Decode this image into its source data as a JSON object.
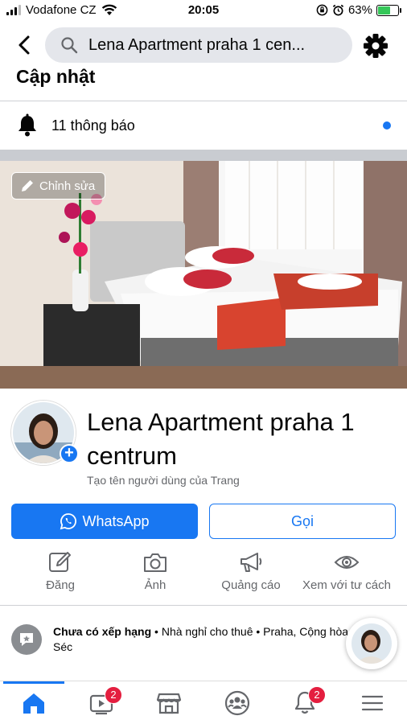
{
  "status_bar": {
    "carrier": "Vodafone CZ",
    "time": "20:05",
    "battery": "63%",
    "battery_level": 0.63
  },
  "header": {
    "search_text": "Lena Apartment praha 1 cen...",
    "icons": [
      "chevron-left-icon",
      "search-icon",
      "gear-icon"
    ]
  },
  "updates": {
    "title": "Cập nhật",
    "notifications": "11 thông báo"
  },
  "cover": {
    "edit_label": "Chỉnh sửa"
  },
  "profile": {
    "name": "Lena Apartment praha 1 centrum",
    "username_hint": "Tạo tên người dùng của Trang"
  },
  "buttons": {
    "whatsapp": "WhatsApp",
    "call": "Gọi"
  },
  "actions": [
    {
      "label": "Đăng",
      "icon": "edit-icon"
    },
    {
      "label": "Ảnh",
      "icon": "camera-icon"
    },
    {
      "label": "Quảng cáo",
      "icon": "megaphone-icon"
    },
    {
      "label": "Xem với tư cách",
      "icon": "eye-icon"
    }
  ],
  "info": {
    "rating": "Chưa có xếp hạng",
    "details": " • Nhà nghỉ cho thuê • Praha, Cộng hòa Séc"
  },
  "bottom_nav": [
    {
      "icon": "home-icon",
      "badge": ""
    },
    {
      "icon": "video-icon",
      "badge": "2"
    },
    {
      "icon": "marketplace-icon",
      "badge": ""
    },
    {
      "icon": "groups-icon",
      "badge": ""
    },
    {
      "icon": "bell-icon",
      "badge": "2"
    },
    {
      "icon": "menu-icon",
      "badge": ""
    }
  ],
  "colors": {
    "accent": "#1877f2",
    "badge": "#e41e3f",
    "secondary_text": "#65676b"
  }
}
